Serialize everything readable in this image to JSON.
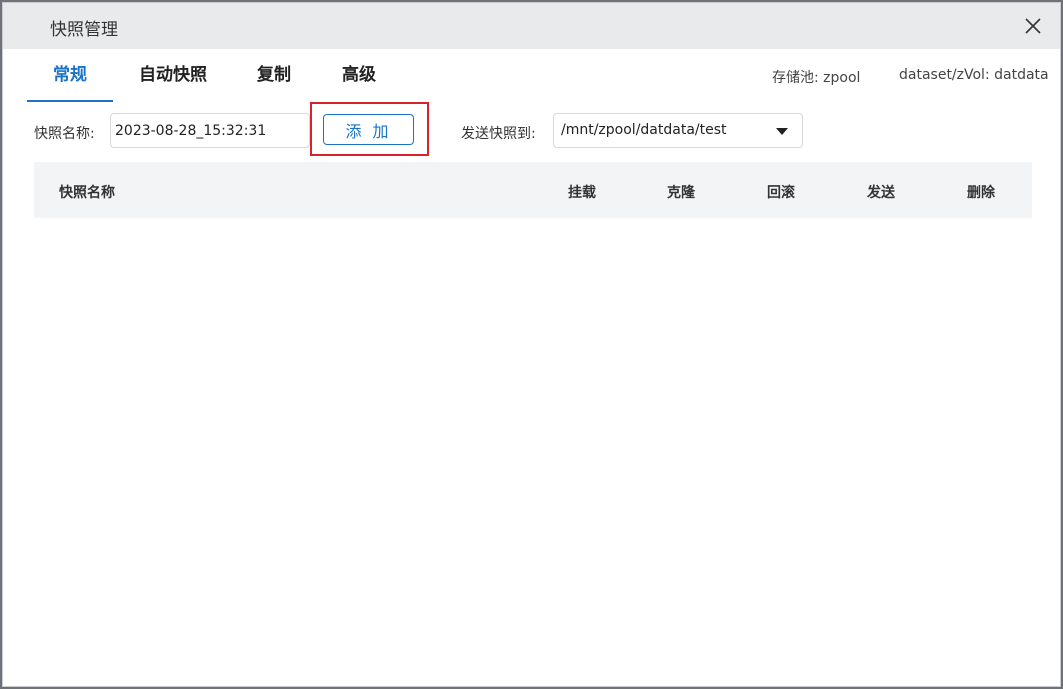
{
  "dialog": {
    "title": "快照管理",
    "close_icon": "close-icon"
  },
  "tabs": [
    {
      "label": "常规",
      "active": true
    },
    {
      "label": "自动快照",
      "active": false
    },
    {
      "label": "复制",
      "active": false
    },
    {
      "label": "高级",
      "active": false
    }
  ],
  "info": {
    "pool": "存储池: zpool",
    "dataset": "dataset/zVol: datdata"
  },
  "form": {
    "name_label": "快照名称:",
    "name_value": "2023-08-28_15:32:31",
    "add_label": "添 加",
    "send_label": "发送快照到:",
    "send_value": "/mnt/zpool/datdata/test"
  },
  "table": {
    "columns": [
      "快照名称",
      "挂载",
      "克隆",
      "回滚",
      "发送",
      "删除"
    ],
    "rows": []
  },
  "colors": {
    "accent": "#1a73c8",
    "highlight": "#d8232a"
  }
}
